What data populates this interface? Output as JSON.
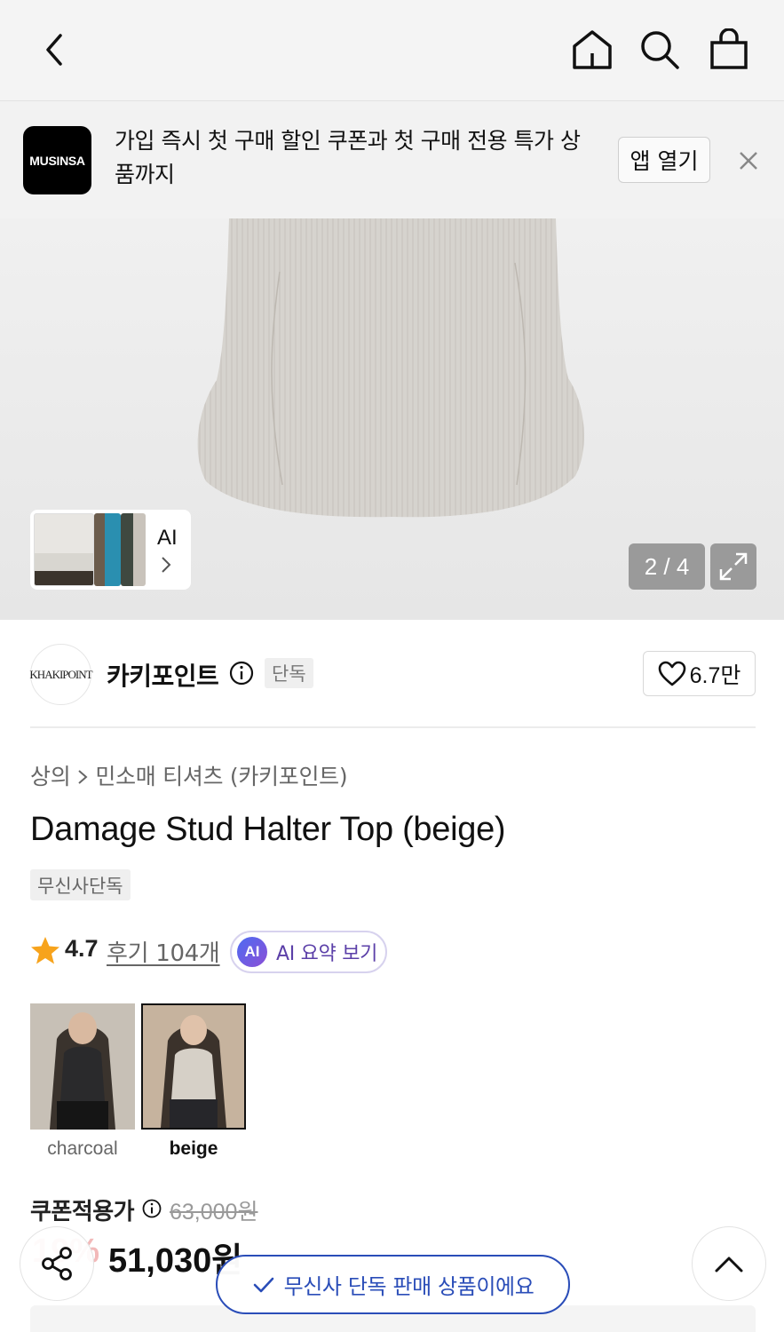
{
  "header": {
    "icons": [
      "back-icon",
      "home-icon",
      "search-icon",
      "shopping-bag-icon"
    ]
  },
  "app_banner": {
    "logo_text": "MUSINSA",
    "message": "가입 즉시 첫 구매 할인 쿠폰과 첫 구매 전용 특가 상품까지",
    "open_button": "앱 열기"
  },
  "product_image": {
    "ai_label": "AI",
    "counter": "2 / 4"
  },
  "brand": {
    "logo_text": "KHAKIPOINT",
    "name": "카키포인트",
    "badge": "단독",
    "like_count": "6.7만"
  },
  "breadcrumb": {
    "category": "상의",
    "subcategory": "민소매 티셔츠 (카키포인트)"
  },
  "product": {
    "title": "Damage Stud Halter Top (beige)",
    "exclusive_tag": "무신사단독"
  },
  "rating": {
    "value": "4.7",
    "reviews": "후기 104개",
    "ai_badge": "AI",
    "ai_summary": "AI 요약 보기"
  },
  "colors": [
    {
      "name": "charcoal",
      "selected": false
    },
    {
      "name": "beige",
      "selected": true
    }
  ],
  "price": {
    "label": "쿠폰적용가",
    "original": "63,000원",
    "discount": "19%",
    "sale": "51,030원"
  },
  "toast": {
    "message": "무신사 단독 판매 상품이에요"
  }
}
